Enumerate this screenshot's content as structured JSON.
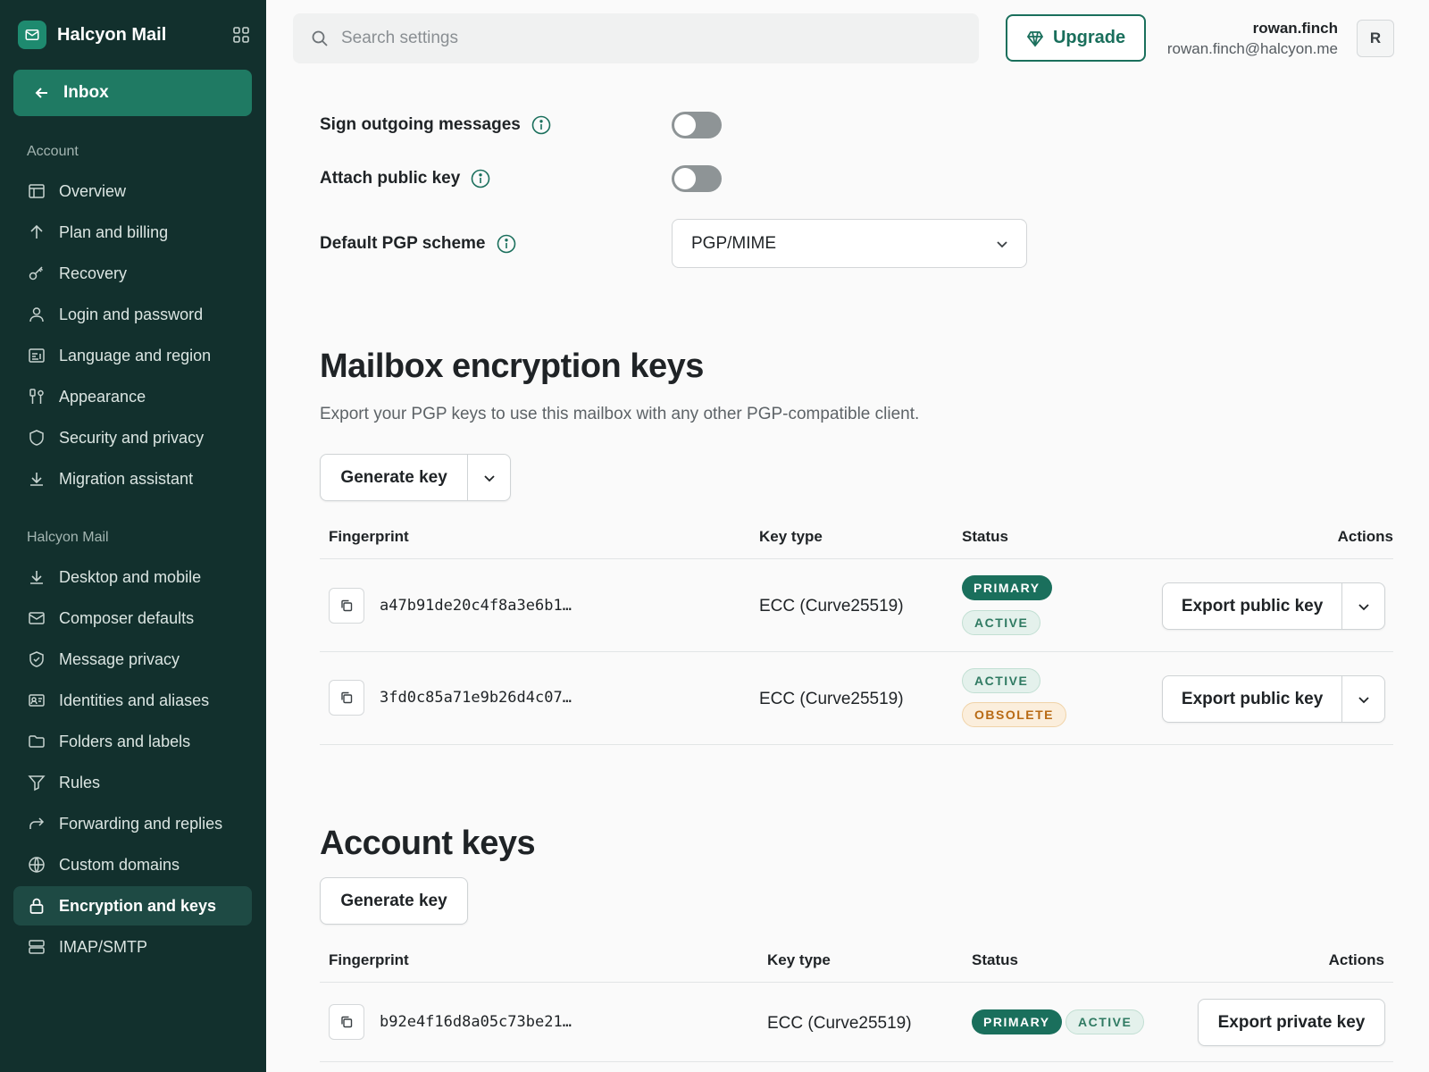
{
  "app": {
    "name": "Halcyon Mail"
  },
  "sidebar": {
    "inbox_label": "Inbox",
    "account_heading": "Account",
    "account_items": [
      {
        "label": "Overview",
        "icon": "layout-icon"
      },
      {
        "label": "Plan and billing",
        "icon": "arrow-up-icon"
      },
      {
        "label": "Recovery",
        "icon": "key-icon"
      },
      {
        "label": "Login and password",
        "icon": "user-icon"
      },
      {
        "label": "Language and region",
        "icon": "language-icon"
      },
      {
        "label": "Appearance",
        "icon": "paint-icon"
      },
      {
        "label": "Security and privacy",
        "icon": "shield-icon"
      },
      {
        "label": "Migration assistant",
        "icon": "download-icon"
      }
    ],
    "mail_heading": "Halcyon Mail",
    "mail_items": [
      {
        "label": "Desktop and mobile",
        "icon": "download-icon"
      },
      {
        "label": "Composer defaults",
        "icon": "envelope-icon"
      },
      {
        "label": "Message privacy",
        "icon": "shield-check-icon"
      },
      {
        "label": "Identities and aliases",
        "icon": "id-card-icon"
      },
      {
        "label": "Folders and labels",
        "icon": "folder-icon"
      },
      {
        "label": "Rules",
        "icon": "filter-icon"
      },
      {
        "label": "Forwarding and replies",
        "icon": "forward-icon"
      },
      {
        "label": "Custom domains",
        "icon": "globe-icon"
      },
      {
        "label": "Encryption and keys",
        "icon": "lock-icon",
        "active": true
      },
      {
        "label": "IMAP/SMTP",
        "icon": "server-icon"
      }
    ]
  },
  "header": {
    "search_placeholder": "Search settings",
    "upgrade_label": "Upgrade",
    "user_name": "rowan.finch",
    "user_email": "rowan.finch@halcyon.me",
    "avatar_initial": "R"
  },
  "settings": {
    "sign_outgoing": {
      "label": "Sign outgoing messages",
      "enabled": false
    },
    "attach_public_key": {
      "label": "Attach public key",
      "enabled": false
    },
    "default_scheme": {
      "label": "Default PGP scheme",
      "value": "PGP/MIME"
    }
  },
  "mailbox_keys": {
    "title": "Mailbox encryption keys",
    "description": "Export your PGP keys to use this mailbox with any other PGP-compatible client.",
    "generate_label": "Generate key",
    "columns": [
      "Fingerprint",
      "Key type",
      "Status",
      "Actions"
    ],
    "rows": [
      {
        "fingerprint": "a47b91de20c4f8a3e6b1…",
        "key_type": "ECC (Curve25519)",
        "badges": [
          "PRIMARY",
          "ACTIVE"
        ],
        "action": "Export public key"
      },
      {
        "fingerprint": "3fd0c85a71e9b26d4c07…",
        "key_type": "ECC (Curve25519)",
        "badges": [
          "ACTIVE",
          "OBSOLETE"
        ],
        "action": "Export public key"
      }
    ]
  },
  "account_keys": {
    "title": "Account keys",
    "generate_label": "Generate key",
    "columns": [
      "Fingerprint",
      "Key type",
      "Status",
      "Actions"
    ],
    "rows": [
      {
        "fingerprint": "b92e4f16d8a05c73be21…",
        "key_type": "ECC (Curve25519)",
        "badges": [
          "PRIMARY",
          "ACTIVE"
        ],
        "action": "Export private key"
      }
    ]
  },
  "colors": {
    "sidebar_bg": "#12302d",
    "accent": "#1a6f5c",
    "active_badge_bg": "#e4f1ec",
    "obsolete_badge_bg": "#fbeedc"
  }
}
